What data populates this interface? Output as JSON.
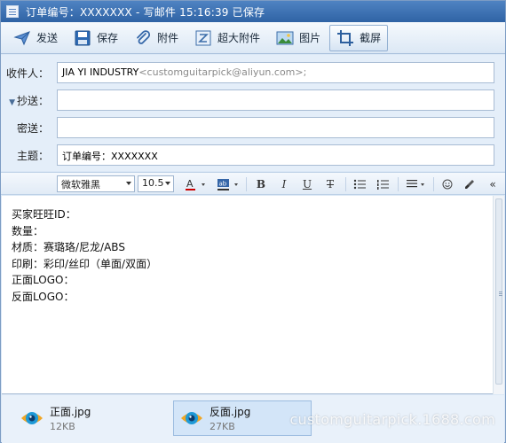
{
  "window": {
    "title": "订单编号：XXXXXXX - 写邮件   15:16:39 已保存"
  },
  "toolbar": {
    "items": [
      {
        "label": "发送",
        "icon": "send-icon"
      },
      {
        "label": "保存",
        "icon": "save-icon"
      },
      {
        "label": "附件",
        "icon": "paperclip-icon"
      },
      {
        "label": "超大附件",
        "icon": "large-attachment-icon"
      },
      {
        "label": "图片",
        "icon": "picture-icon"
      },
      {
        "label": "截屏",
        "icon": "screenshot-icon"
      }
    ]
  },
  "headers": {
    "to_label": "收件人：",
    "to_name": "JIA YI INDUSTRY",
    "to_addr": "<customguitarpick@aliyun.com>;",
    "cc_label": "抄送：",
    "bcc_label": "密送：",
    "subject_label": "主题：",
    "subject_value": "订单编号：XXXXXXX"
  },
  "format": {
    "font": "微软雅黑",
    "size": "10.5",
    "bold": "B",
    "italic": "I",
    "underline": "U",
    "strike": "T",
    "more": "«"
  },
  "body": {
    "lines": [
      "买家旺旺ID：",
      "数量：",
      "材质：赛璐珞/尼龙/ABS",
      "印刷：彩印/丝印（单面/双面）",
      "正面LOGO：",
      "反面LOGO："
    ]
  },
  "attachments": [
    {
      "name": "正面.jpg",
      "size": "12KB"
    },
    {
      "name": "反面.jpg",
      "size": "27KB"
    }
  ],
  "watermark": "customguitarpick.1688.com",
  "colors": {
    "titlebar": "#2f63a5",
    "accent": "#3a6fb0",
    "background": "#dbe8f6"
  }
}
